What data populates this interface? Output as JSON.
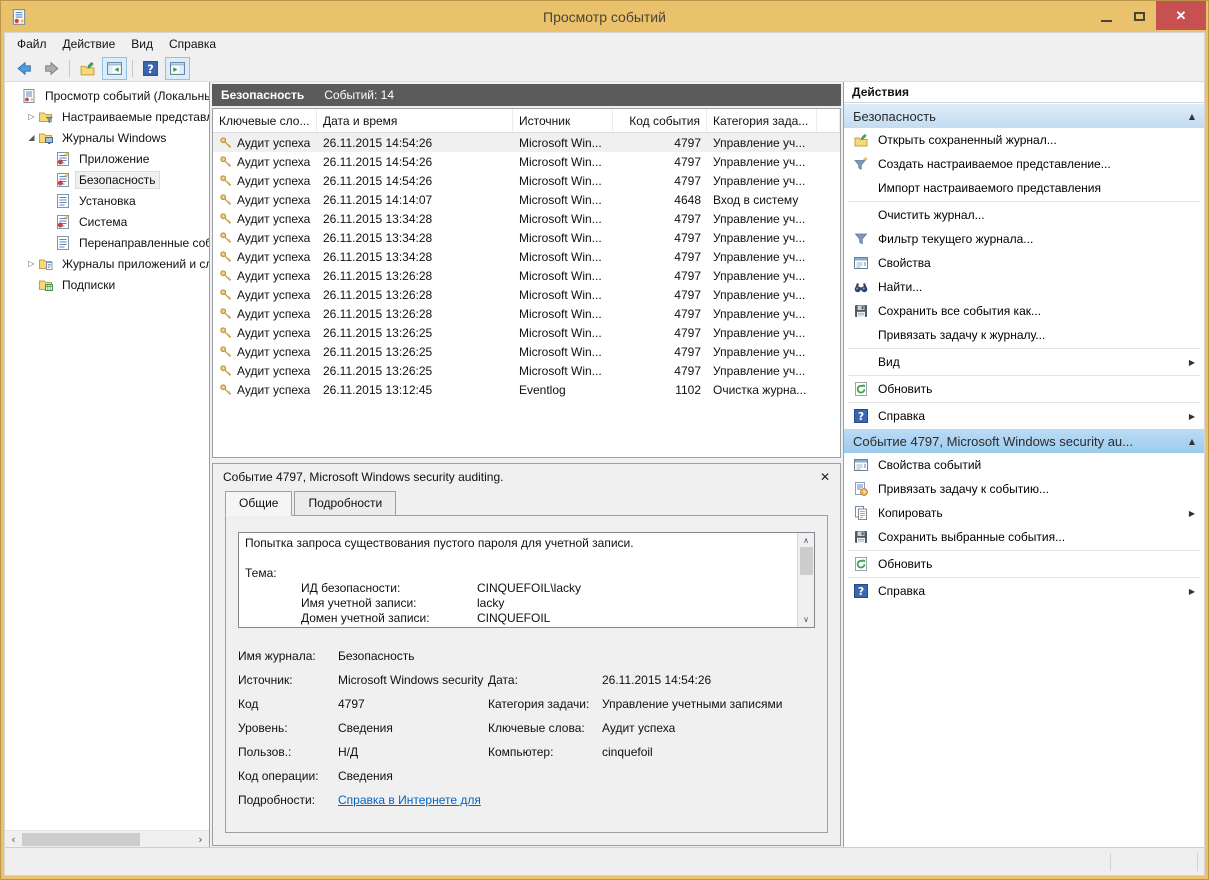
{
  "window": {
    "title": "Просмотр событий"
  },
  "colors": {
    "titlebar_gold": "#e9c26b",
    "close_red": "#c75050",
    "log_header_gray": "#5b5b5b",
    "section_header_blue": "#9ccbee",
    "link_blue": "#0563c1"
  },
  "menu": {
    "items": [
      "Файл",
      "Действие",
      "Вид",
      "Справка"
    ]
  },
  "toolbar": {
    "buttons": [
      "back-icon",
      "forward-icon",
      "open-saved-log-icon",
      "show-console-tree-icon",
      "help-icon",
      "show-action-pane-icon"
    ]
  },
  "tree": {
    "items": [
      {
        "label": "Просмотр событий (Локальнь",
        "icon": "eventviewer",
        "level": 0,
        "expander": "none",
        "selected": false
      },
      {
        "label": "Настраиваемые представле",
        "icon": "folder-filter",
        "level": 1,
        "expander": "collapsed",
        "selected": false
      },
      {
        "label": "Журналы Windows",
        "icon": "folder-windows",
        "level": 1,
        "expander": "expanded",
        "selected": false
      },
      {
        "label": "Приложение",
        "icon": "log-alert",
        "level": 2,
        "expander": "none",
        "selected": false
      },
      {
        "label": "Безопасность",
        "icon": "log-alert",
        "level": 2,
        "expander": "none",
        "selected": true
      },
      {
        "label": "Установка",
        "icon": "log",
        "level": 2,
        "expander": "none",
        "selected": false
      },
      {
        "label": "Система",
        "icon": "log-alert",
        "level": 2,
        "expander": "none",
        "selected": false
      },
      {
        "label": "Перенаправленные соб",
        "icon": "log",
        "level": 2,
        "expander": "none",
        "selected": false
      },
      {
        "label": "Журналы приложений и сл",
        "icon": "folder-apps",
        "level": 1,
        "expander": "collapsed",
        "selected": false
      },
      {
        "label": "Подписки",
        "icon": "subscriptions",
        "level": 1,
        "expander": "none",
        "selected": false
      }
    ]
  },
  "list": {
    "title": "Безопасность",
    "count_label": "Событий: 14",
    "row_icon": "key-icon",
    "columns": [
      "Ключевые сло...",
      "Дата и время",
      "Источник",
      "Код события",
      "Категория зада..."
    ],
    "rows": [
      {
        "keywords": "Аудит успеха",
        "datetime": "26.11.2015 14:54:26",
        "source": "Microsoft Win...",
        "event_id": "4797",
        "category": "Управление уч..."
      },
      {
        "keywords": "Аудит успеха",
        "datetime": "26.11.2015 14:54:26",
        "source": "Microsoft Win...",
        "event_id": "4797",
        "category": "Управление уч..."
      },
      {
        "keywords": "Аудит успеха",
        "datetime": "26.11.2015 14:54:26",
        "source": "Microsoft Win...",
        "event_id": "4797",
        "category": "Управление уч..."
      },
      {
        "keywords": "Аудит успеха",
        "datetime": "26.11.2015 14:14:07",
        "source": "Microsoft Win...",
        "event_id": "4648",
        "category": "Вход в систему"
      },
      {
        "keywords": "Аудит успеха",
        "datetime": "26.11.2015 13:34:28",
        "source": "Microsoft Win...",
        "event_id": "4797",
        "category": "Управление уч..."
      },
      {
        "keywords": "Аудит успеха",
        "datetime": "26.11.2015 13:34:28",
        "source": "Microsoft Win...",
        "event_id": "4797",
        "category": "Управление уч..."
      },
      {
        "keywords": "Аудит успеха",
        "datetime": "26.11.2015 13:34:28",
        "source": "Microsoft Win...",
        "event_id": "4797",
        "category": "Управление уч..."
      },
      {
        "keywords": "Аудит успеха",
        "datetime": "26.11.2015 13:26:28",
        "source": "Microsoft Win...",
        "event_id": "4797",
        "category": "Управление уч..."
      },
      {
        "keywords": "Аудит успеха",
        "datetime": "26.11.2015 13:26:28",
        "source": "Microsoft Win...",
        "event_id": "4797",
        "category": "Управление уч..."
      },
      {
        "keywords": "Аудит успеха",
        "datetime": "26.11.2015 13:26:28",
        "source": "Microsoft Win...",
        "event_id": "4797",
        "category": "Управление уч..."
      },
      {
        "keywords": "Аудит успеха",
        "datetime": "26.11.2015 13:26:25",
        "source": "Microsoft Win...",
        "event_id": "4797",
        "category": "Управление уч..."
      },
      {
        "keywords": "Аудит успеха",
        "datetime": "26.11.2015 13:26:25",
        "source": "Microsoft Win...",
        "event_id": "4797",
        "category": "Управление уч..."
      },
      {
        "keywords": "Аудит успеха",
        "datetime": "26.11.2015 13:26:25",
        "source": "Microsoft Win...",
        "event_id": "4797",
        "category": "Управление уч..."
      },
      {
        "keywords": "Аудит успеха",
        "datetime": "26.11.2015 13:12:45",
        "source": "Eventlog",
        "event_id": "1102",
        "category": "Очистка журна..."
      }
    ]
  },
  "detail": {
    "header": "Событие 4797, Microsoft Windows security auditing.",
    "tabs": [
      "Общие",
      "Подробности"
    ],
    "active_tab": "Общие",
    "description_lines": [
      {
        "text": "Попытка запроса существования пустого пароля для учетной записи."
      },
      {
        "text": ""
      },
      {
        "text": "Тема:"
      },
      {
        "label": "ИД безопасности:",
        "value": "CINQUEFOIL\\lacky"
      },
      {
        "label": "Имя учетной записи:",
        "value": "lacky"
      },
      {
        "label": "Домен учетной записи:",
        "value": "CINQUEFOIL"
      }
    ],
    "fields": [
      {
        "l1": "Имя журнала:",
        "v1": "Безопасность",
        "l2": "",
        "v2": ""
      },
      {
        "l1": "Источник:",
        "v1": "Microsoft Windows security",
        "l2": "Дата:",
        "v2": "26.11.2015 14:54:26"
      },
      {
        "l1": "Код",
        "v1": "4797",
        "l2": "Категория задачи:",
        "v2": "Управление учетными записями"
      },
      {
        "l1": "Уровень:",
        "v1": "Сведения",
        "l2": "Ключевые слова:",
        "v2": "Аудит успеха"
      },
      {
        "l1": "Пользов.:",
        "v1": "Н/Д",
        "l2": "Компьютер:",
        "v2": "cinquefoil"
      },
      {
        "l1": "Код операции:",
        "v1": "Сведения",
        "l2": "",
        "v2": ""
      },
      {
        "l1": "Подробности:",
        "v1": "Справка в Интернете для",
        "l2": "",
        "v2": "",
        "link": true
      }
    ]
  },
  "actions": {
    "title": "Действия",
    "sections": [
      {
        "header": "Безопасность",
        "items": [
          {
            "label": "Открыть сохраненный журнал...",
            "icon": "open-folder",
            "submenu": false,
            "sep": false
          },
          {
            "label": "Создать настраиваемое представление...",
            "icon": "funnel-new",
            "submenu": false,
            "sep": false
          },
          {
            "label": "Импорт настраиваемого представления",
            "icon": "none",
            "submenu": false,
            "sep": true
          },
          {
            "label": "Очистить журнал...",
            "icon": "none",
            "submenu": false,
            "sep": false
          },
          {
            "label": "Фильтр текущего журнала...",
            "icon": "funnel",
            "submenu": false,
            "sep": false
          },
          {
            "label": "Свойства",
            "icon": "properties",
            "submenu": false,
            "sep": false
          },
          {
            "label": "Найти...",
            "icon": "find",
            "submenu": false,
            "sep": false
          },
          {
            "label": "Сохранить все события как...",
            "icon": "save",
            "submenu": false,
            "sep": false
          },
          {
            "label": "Привязать задачу к журналу...",
            "icon": "none",
            "submenu": false,
            "sep": true
          },
          {
            "label": "Вид",
            "icon": "none",
            "submenu": true,
            "sep": true
          },
          {
            "label": "Обновить",
            "icon": "refresh",
            "submenu": false,
            "sep": true
          },
          {
            "label": "Справка",
            "icon": "help",
            "submenu": true,
            "sep": false
          }
        ]
      },
      {
        "header": "Событие 4797, Microsoft Windows security au...",
        "items": [
          {
            "label": "Свойства событий",
            "icon": "properties",
            "submenu": false,
            "sep": false
          },
          {
            "label": "Привязать задачу к событию...",
            "icon": "task",
            "submenu": false,
            "sep": false
          },
          {
            "label": "Копировать",
            "icon": "copy",
            "submenu": true,
            "sep": false
          },
          {
            "label": "Сохранить выбранные события...",
            "icon": "save",
            "submenu": false,
            "sep": true
          },
          {
            "label": "Обновить",
            "icon": "refresh",
            "submenu": false,
            "sep": true
          },
          {
            "label": "Справка",
            "icon": "help",
            "submenu": true,
            "sep": false
          }
        ]
      }
    ]
  }
}
